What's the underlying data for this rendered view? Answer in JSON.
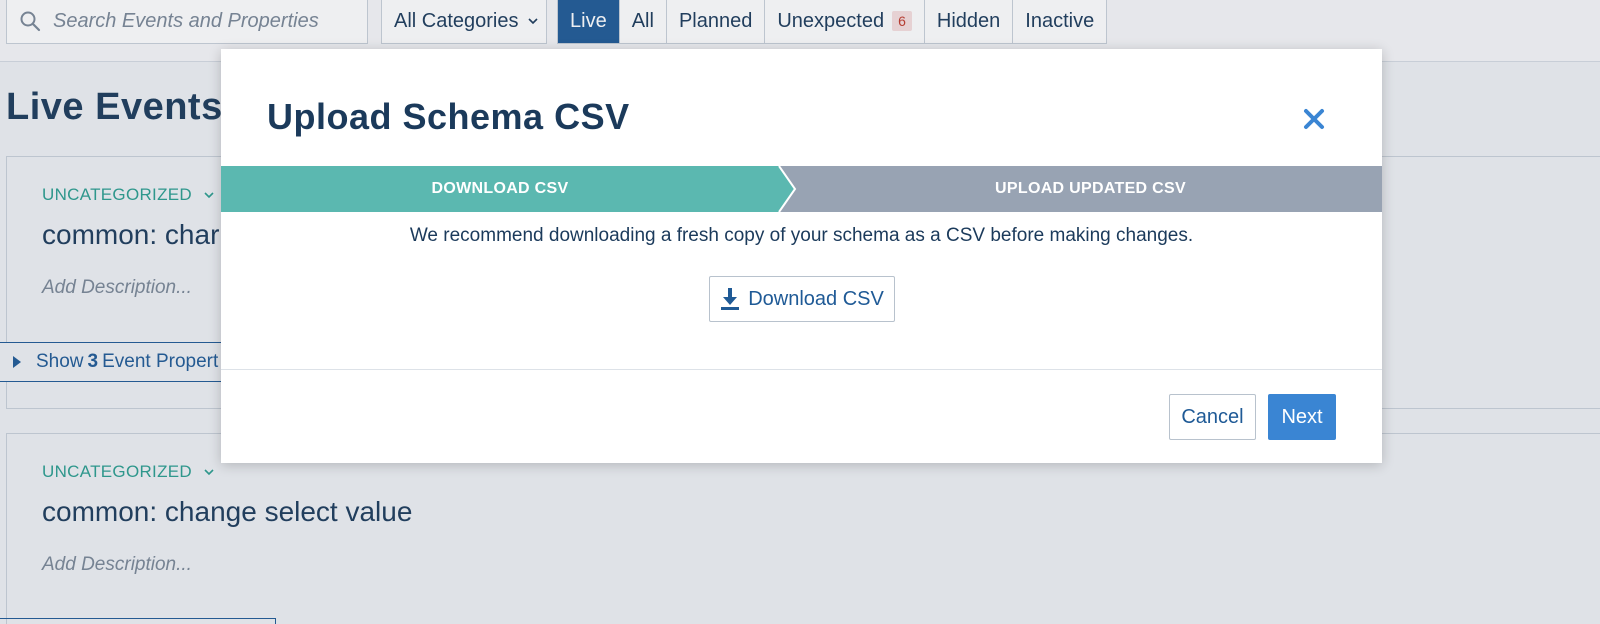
{
  "topbar": {
    "search": {
      "placeholder": "Search Events and Properties",
      "icon": "search-icon"
    },
    "category_filter": {
      "selected": "All Categories",
      "icon": "chevron-down-icon"
    },
    "tabs": [
      {
        "label": "Live",
        "active": true
      },
      {
        "label": "All",
        "active": false
      },
      {
        "label": "Planned",
        "active": false
      },
      {
        "label": "Unexpected",
        "active": false,
        "badge": "6"
      },
      {
        "label": "Hidden",
        "active": false
      },
      {
        "label": "Inactive",
        "active": false
      }
    ]
  },
  "background": {
    "title": "Live Events c",
    "cards": [
      {
        "category": "UNCATEGORIZED",
        "event_name": "common: char",
        "description_placeholder": "Add Description...",
        "show_properties": {
          "prefix": "Show",
          "count": "3",
          "suffix": "Event Propert"
        }
      },
      {
        "category": "UNCATEGORIZED",
        "event_name": "common: change select value",
        "description_placeholder": "Add Description..."
      }
    ]
  },
  "modal": {
    "title": "Upload Schema CSV",
    "close_icon": "close-icon",
    "steps": [
      {
        "label": "DOWNLOAD CSV",
        "active": true
      },
      {
        "label": "UPLOAD UPDATED CSV",
        "active": false
      }
    ],
    "message": "We recommend downloading a fresh copy of your schema as a CSV before making changes.",
    "download_button": {
      "label": "Download CSV",
      "icon": "download-icon"
    },
    "cancel_label": "Cancel",
    "next_label": "Next"
  },
  "colors": {
    "primary": "#1f5a96",
    "accent_button": "#3a85d3",
    "step_active": "#5bb8b0",
    "step_inactive": "#98a3b3",
    "category_teal": "#2a9d8f",
    "text_dark": "#1b3a5b"
  }
}
